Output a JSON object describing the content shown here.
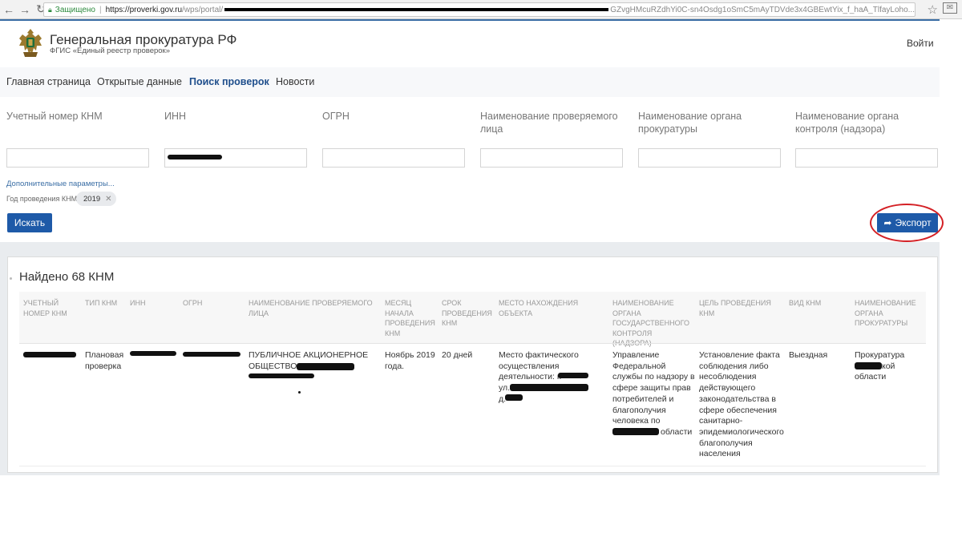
{
  "browser": {
    "back_icon": "arrow-left-icon",
    "forward_icon": "arrow-right-icon",
    "reload_icon": "reload-icon",
    "secure_label": "Защищено",
    "url_host": "https://proverki.gov.ru",
    "url_path": "/wps/portal/",
    "url_tail": "GZvgHMcuRZdhYi0C-sn4Osdg1oSmC5mAyTDVde3x4GBEwtYix_f_haA_TlfayLoho..."
  },
  "header": {
    "title": "Генеральная прокуратура РФ",
    "subtitle": "ФГИС «Единый реестр проверок»",
    "login": "Войти"
  },
  "nav": {
    "items": [
      "Главная страница",
      "Открытые данные",
      "Поиск проверок",
      "Новости"
    ],
    "active": "Поиск проверок"
  },
  "filters": {
    "labels": [
      "Учетный номер КНМ",
      "ИНН",
      "ОГРН",
      "Наименование проверяемого лица",
      "Наименование органа прокуратуры",
      "Наименование органа контроля (надзора)"
    ],
    "more_params": "Дополнительные параметры...",
    "year_label": "Год проведения КНМ",
    "year_value": "2019",
    "search_button": "Искать",
    "export_button": "Экспорт"
  },
  "results": {
    "found": "Найдено 68 КНМ",
    "columns": [
      "Учетный номер КНМ",
      "Тип КНМ",
      "ИНН",
      "ОГРН",
      "Наименование проверяемого лица",
      "Месяц начала проведения КНМ",
      "Срок проведения КНМ",
      "Место нахождения объекта",
      "Наименование органа государственного контроля (надзора)",
      "Цель проведения КНМ",
      "Вид КНМ",
      "Наименование органа прокуратуры"
    ],
    "row": {
      "type": "Плановая проверка",
      "subject": "ПУБЛИЧНОЕ АКЦИОНЕРНОЕ ОБЩЕСТВО",
      "month": "Ноябрь 2019 года.",
      "duration": "20 дней",
      "location_line1": "Место фактического",
      "location_line2": "осуществления",
      "location_line3": "деятельности: г.",
      "location_line4": "ул.",
      "location_line5": "д.",
      "authority_lines": [
        "Управление",
        "Федеральной",
        "службы по надзору в",
        "сфере защиты прав",
        "потребителей и",
        "благополучия",
        "человека по"
      ],
      "authority_end": "области",
      "goal": "Установление факта соблюдения либо несоблюдения действующего законодательства в сфере обеспечения санитарно-эпидемиологического благополучия населения",
      "kind": "Выездная",
      "prosecutor_line1": "Прокуратура",
      "prosecutor_end": "кой",
      "prosecutor_line3": "области"
    }
  }
}
